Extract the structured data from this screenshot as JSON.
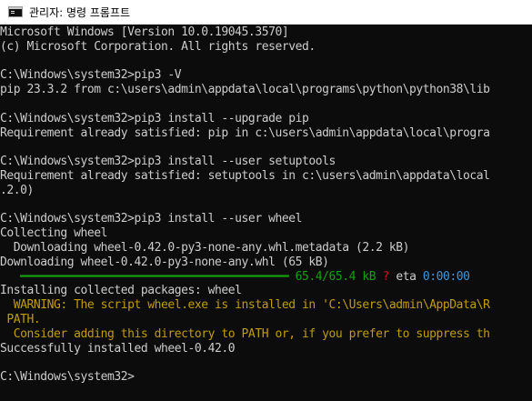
{
  "window": {
    "title": "관리자: 명령 프롬프트",
    "icon": "console-icon"
  },
  "console": {
    "lines": [
      "Microsoft Windows [Version 10.0.19045.3570]",
      "(c) Microsoft Corporation. All rights reserved.",
      "",
      "C:\\Windows\\system32>pip3 -V",
      "pip 23.3.2 from c:\\users\\admin\\appdata\\local\\programs\\python\\python38\\lib",
      "",
      "C:\\Windows\\system32>pip3 install --upgrade pip",
      "Requirement already satisfied: pip in c:\\users\\admin\\appdata\\local\\progra",
      "",
      "C:\\Windows\\system32>pip3 install --user setuptools",
      "Requirement already satisfied: setuptools in c:\\users\\admin\\appdata\\local",
      ".2.0)",
      "",
      "C:\\Windows\\system32>pip3 install --user wheel",
      "Collecting wheel",
      "  Downloading wheel-0.42.0-py3-none-any.whl.metadata (2.2 kB)",
      "Downloading wheel-0.42.0-py3-none-any.whl (65 kB)"
    ],
    "progress": {
      "indent": "   ",
      "bar": "━━━━━━━━━━━━━━━━━━━━━━━━━━━━━━━━━━━━━━━━",
      "size": "65.4/65.4 kB",
      "speed": "?",
      "eta_label": "eta",
      "eta_value": "0:00:00",
      "fraction": 1.0
    },
    "lines_after": [
      "Installing collected packages: wheel"
    ],
    "warning_lines": [
      "  WARNING: The script wheel.exe is installed in 'C:\\Users\\admin\\AppData\\R",
      " PATH.",
      "  Consider adding this directory to PATH or, if you prefer to suppress th"
    ],
    "final_lines": [
      "Successfully installed wheel-0.42.0",
      "",
      "C:\\Windows\\system32>"
    ]
  },
  "colors": {
    "background": "#0c0c0c",
    "foreground": "#cccccc",
    "progress_bar": "#13a10e",
    "progress_size": "#13a10e",
    "speed": "#c50f1f",
    "eta": "#3a96dd",
    "warning": "#c19c00"
  }
}
